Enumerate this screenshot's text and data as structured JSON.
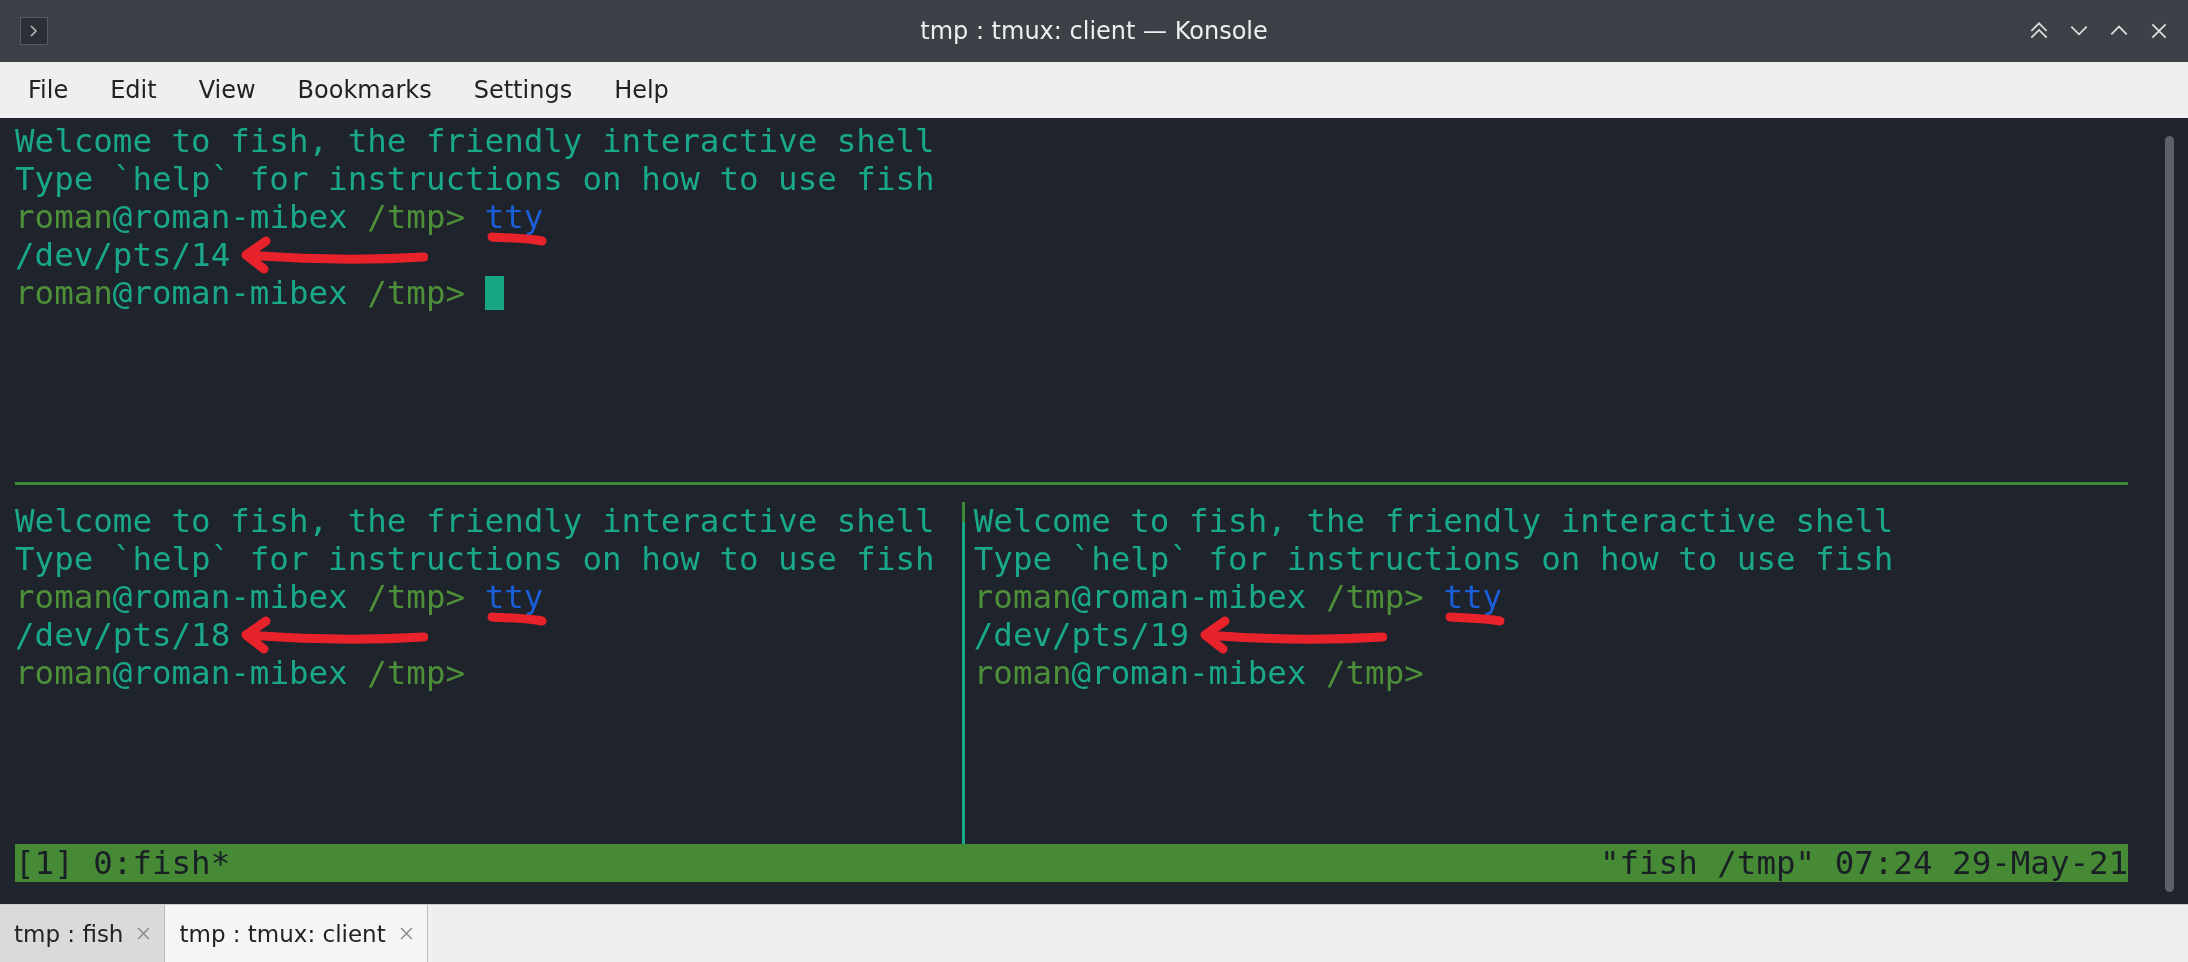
{
  "window": {
    "title": "tmp : tmux: client — Konsole"
  },
  "menu": [
    "File",
    "Edit",
    "View",
    "Bookmarks",
    "Settings",
    "Help"
  ],
  "top_pane": {
    "cursor": true,
    "lines": [
      {
        "kind": "output",
        "text": "Welcome to fish, the friendly interactive shell",
        "marked": false
      },
      {
        "kind": "output",
        "text": "Type `help` for instructions on how to use fish",
        "marked": false
      },
      {
        "kind": "prompt",
        "user": "roman",
        "host": "@roman-mibex",
        "cwd": "/tmp>",
        "command": "tty",
        "marked": true
      },
      {
        "kind": "output",
        "text": "/dev/pts/14",
        "marked": true
      },
      {
        "kind": "prompt",
        "user": "roman",
        "host": "@roman-mibex",
        "cwd": "/tmp>",
        "marked": false
      }
    ]
  },
  "bottom_panes": [
    {
      "cursor": false,
      "lines": [
        {
          "kind": "output",
          "text": "Welcome to fish, the friendly interactive shell",
          "marked": false
        },
        {
          "kind": "output",
          "text": "Type `help` for instructions on how to use fish",
          "marked": false
        },
        {
          "kind": "prompt",
          "user": "roman",
          "host": "@roman-mibex",
          "cwd": "/tmp>",
          "command": "tty",
          "marked": true
        },
        {
          "kind": "output",
          "text": "/dev/pts/18",
          "marked": true
        },
        {
          "kind": "prompt",
          "user": "roman",
          "host": "@roman-mibex",
          "cwd": "/tmp>",
          "marked": false
        }
      ]
    },
    {
      "cursor": false,
      "lines": [
        {
          "kind": "output",
          "text": "Welcome to fish, the friendly interactive shell",
          "marked": false
        },
        {
          "kind": "output",
          "text": "Type `help` for instructions on how to use fish",
          "marked": false
        },
        {
          "kind": "prompt",
          "user": "roman",
          "host": "@roman-mibex",
          "cwd": "/tmp>",
          "command": "tty",
          "marked": true
        },
        {
          "kind": "output",
          "text": "/dev/pts/19",
          "marked": true
        },
        {
          "kind": "prompt",
          "user": "roman",
          "host": "@roman-mibex",
          "cwd": "/tmp>",
          "marked": false
        }
      ]
    }
  ],
  "status_bar": {
    "left": "[1] 0:fish*",
    "right": "\"fish /tmp\" 07:24 29-May-21"
  },
  "tabs": [
    {
      "label": "tmp : fish",
      "selected": false
    },
    {
      "label": "tmp : tmux: client",
      "selected": true
    }
  ]
}
